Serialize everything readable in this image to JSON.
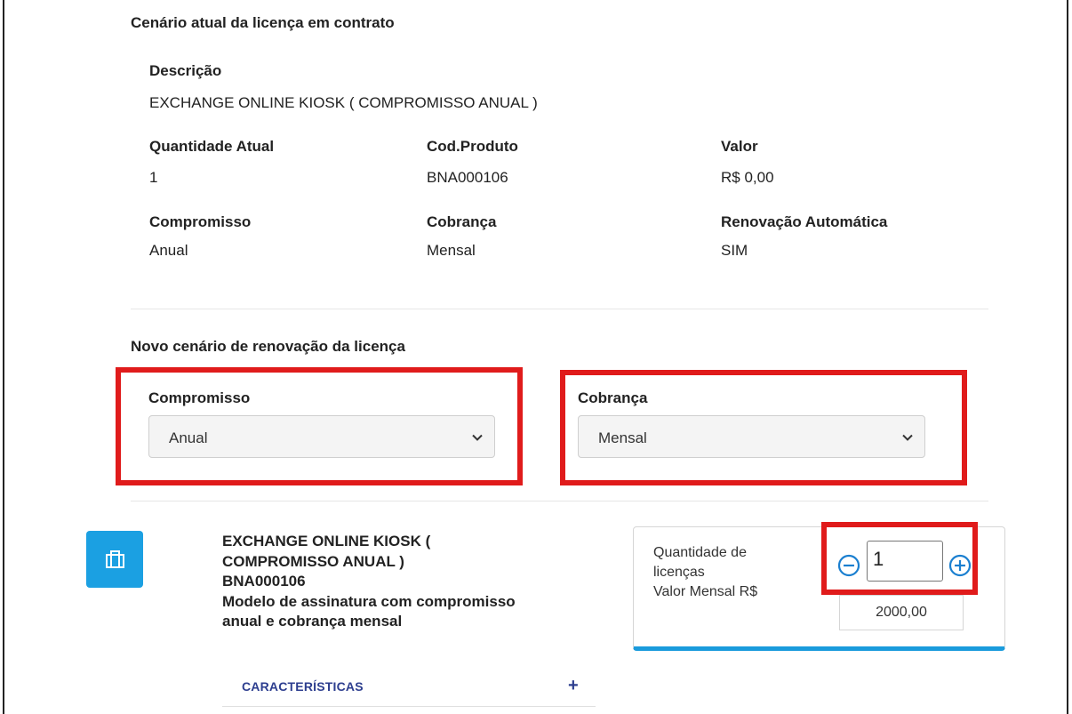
{
  "current": {
    "section_title": "Cenário atual da licença em contrato",
    "description_label": "Descrição",
    "description_value": "EXCHANGE ONLINE KIOSK ( COMPROMISSO ANUAL )",
    "fields": [
      {
        "label": "Quantidade Atual",
        "value": "1"
      },
      {
        "label": "Cod.Produto",
        "value": "BNA000106"
      },
      {
        "label": "Valor",
        "value": "R$ 0,00"
      },
      {
        "label": "Compromisso",
        "value": "Anual"
      },
      {
        "label": "Cobrança",
        "value": "Mensal"
      },
      {
        "label": "Renovação Automática",
        "value": "SIM"
      }
    ]
  },
  "renewal": {
    "section_title": "Novo cenário de renovação da licença",
    "commitment_label": "Compromisso",
    "commitment_selected": "Anual",
    "billing_label": "Cobrança",
    "billing_selected": "Mensal"
  },
  "product": {
    "icon": "briefcase-icon",
    "title_line1": "EXCHANGE ONLINE KIOSK (",
    "title_line2": "COMPROMISSO ANUAL )",
    "code": "BNA000106",
    "desc_line1": "Modelo de assinatura com compromisso",
    "desc_line2": "anual e cobrança mensal",
    "characteristics_label": "CARACTERÍSTICAS",
    "characteristics_toggle": "+"
  },
  "quantity_card": {
    "qty_label_line1": "Quantidade de",
    "qty_label_line2": "licenças",
    "qty_value": "1",
    "monthly_label": "Valor Mensal R$",
    "monthly_value": "2000,00"
  },
  "colors": {
    "highlight": "#e01b1b",
    "accent": "#1a9bdc",
    "link": "#2d3e8f"
  }
}
